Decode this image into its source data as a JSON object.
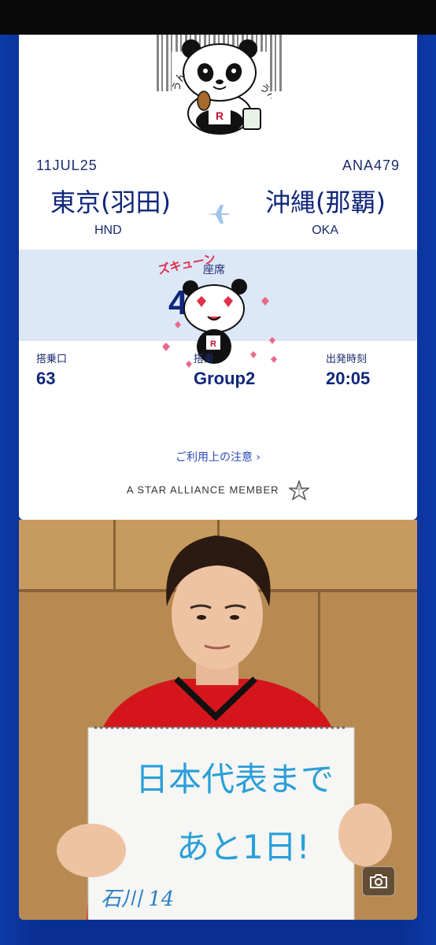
{
  "flight": {
    "date": "11JUL25",
    "number": "ANA479",
    "from_city": "東京(羽田)",
    "to_city": "沖縄(那覇)",
    "from_code": "HND",
    "to_code": "OKA"
  },
  "seat": {
    "label": "座席",
    "value": "40"
  },
  "boarding": {
    "gate_label": "搭乗口",
    "gate_value": "63",
    "group_label": "搭乗",
    "group_value": "Group2",
    "departure_label": "出発時刻",
    "departure_value": "20:05"
  },
  "links": {
    "notice": "ご利用上の注意 ›"
  },
  "alliance": {
    "text": "A STAR ALLIANCE MEMBER"
  },
  "stickers": {
    "panda_top_text_left": "うん",
    "panda_top_text_right": "うん",
    "panda_heart_text": "ズキューン",
    "panda_logo": "R"
  },
  "photo": {
    "sign_line1": "日本代表まで",
    "sign_line2": "あと1日!",
    "signature": "石川 14"
  },
  "colors": {
    "brand_navy": "#10267a",
    "seat_band": "#dce7f7",
    "background_blue": "#0a2f93"
  }
}
